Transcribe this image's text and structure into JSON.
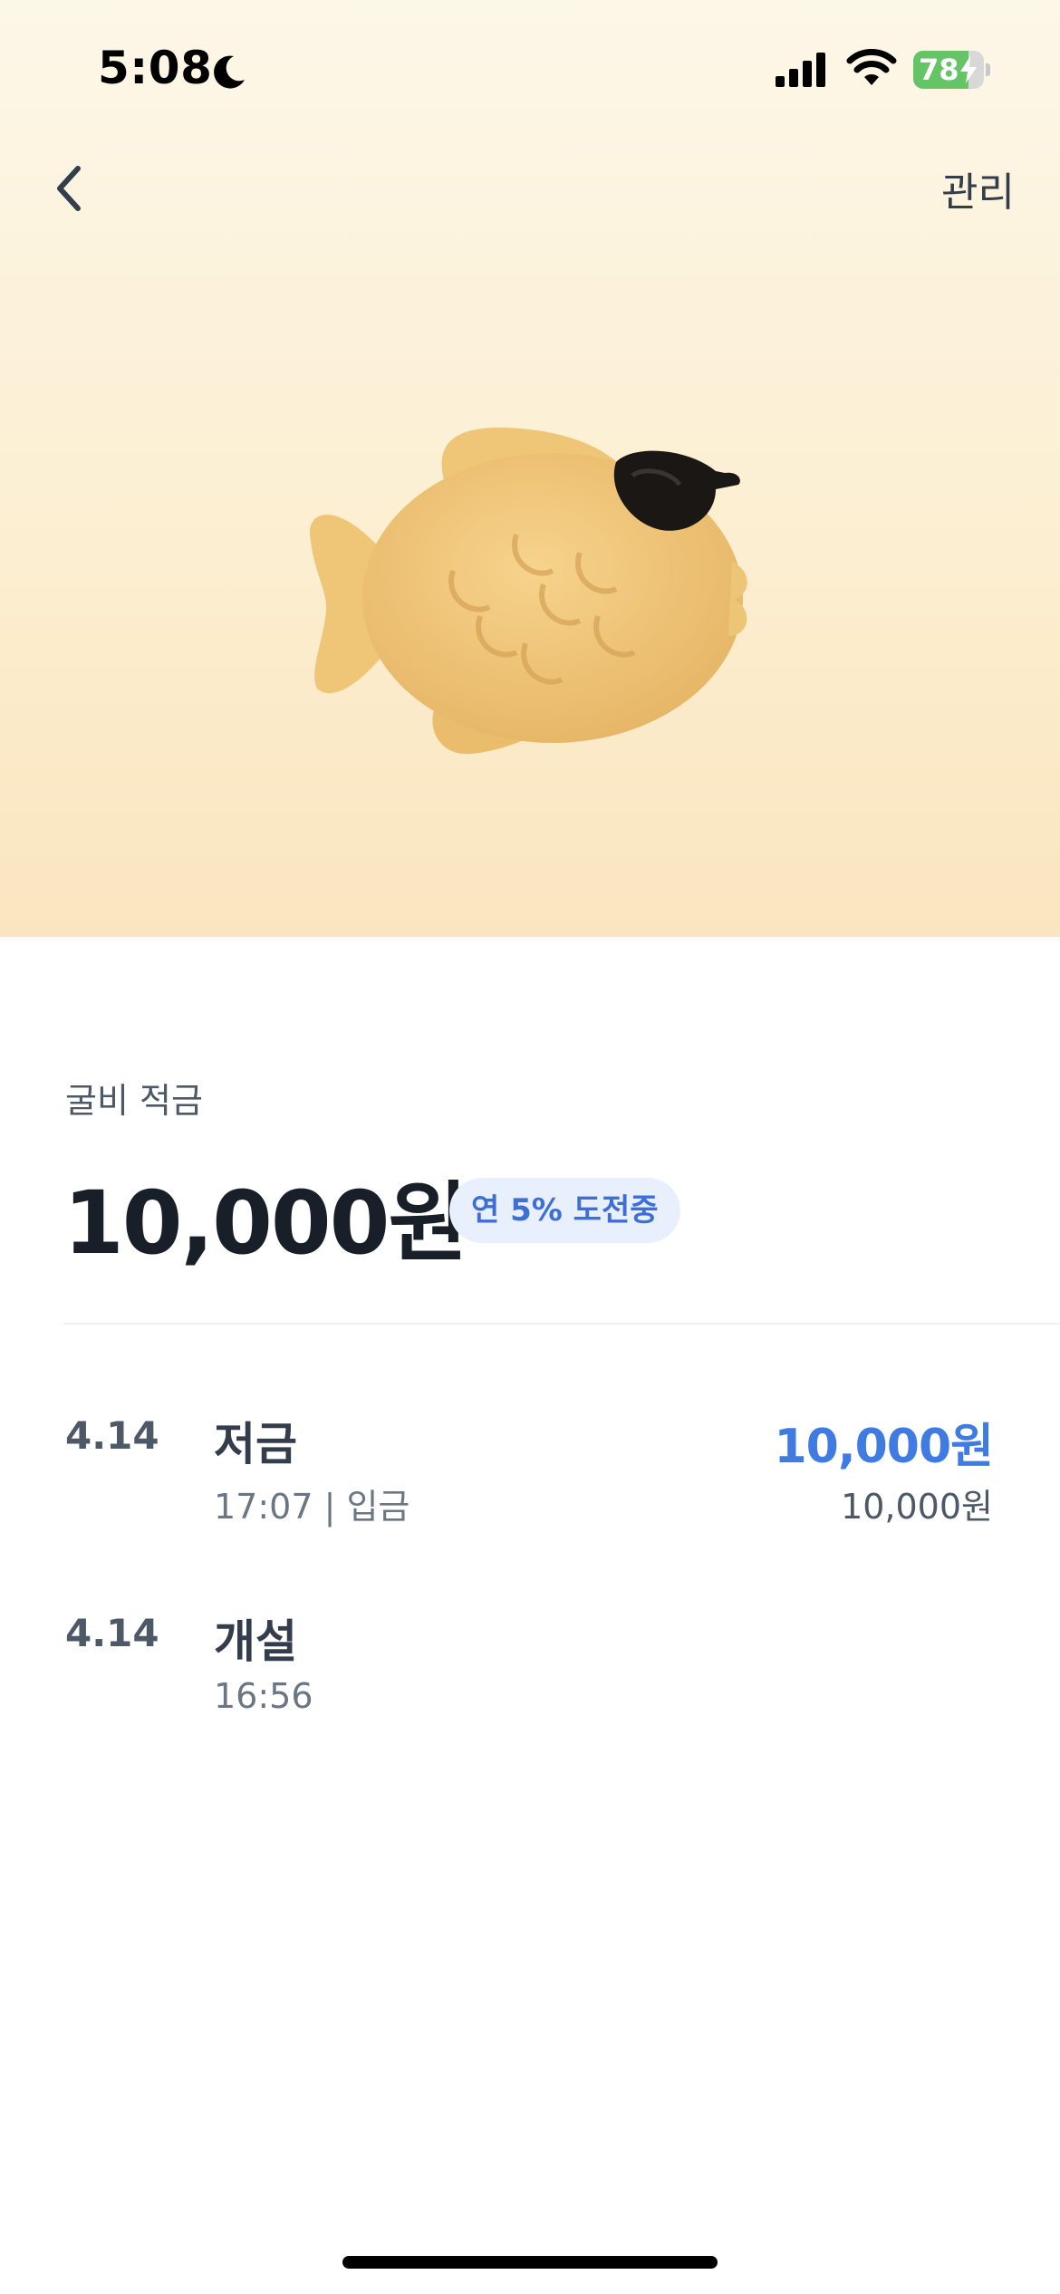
{
  "status_bar": {
    "time": "5:08",
    "battery_level": "78",
    "battery_fraction": 0.78,
    "icons": [
      "moon-icon",
      "cellular-signal-icon",
      "wifi-icon",
      "battery-charging-icon"
    ]
  },
  "nav": {
    "back_icon": "chevron-left-icon",
    "manage_label": "관리"
  },
  "hero": {
    "illustration": "fish-bread-with-sunglasses",
    "background_colors": [
      "#fdf7e8",
      "#fae5bf"
    ]
  },
  "account": {
    "name": "굴비 적금",
    "balance": "10,000원",
    "rate_badge": "연 5% 도전중"
  },
  "transactions": [
    {
      "date": "4.14",
      "title": "저금",
      "detail": "17:07 | 입금",
      "amount": "10,000원",
      "balance_after": "10,000원"
    },
    {
      "date": "4.14",
      "title": "개설",
      "detail": "16:56",
      "amount": "",
      "balance_after": ""
    }
  ],
  "colors": {
    "accent_blue": "#3f7be0",
    "badge_bg": "#e8f0fd",
    "text_primary": "#191f28",
    "text_secondary": "#6b7684"
  }
}
